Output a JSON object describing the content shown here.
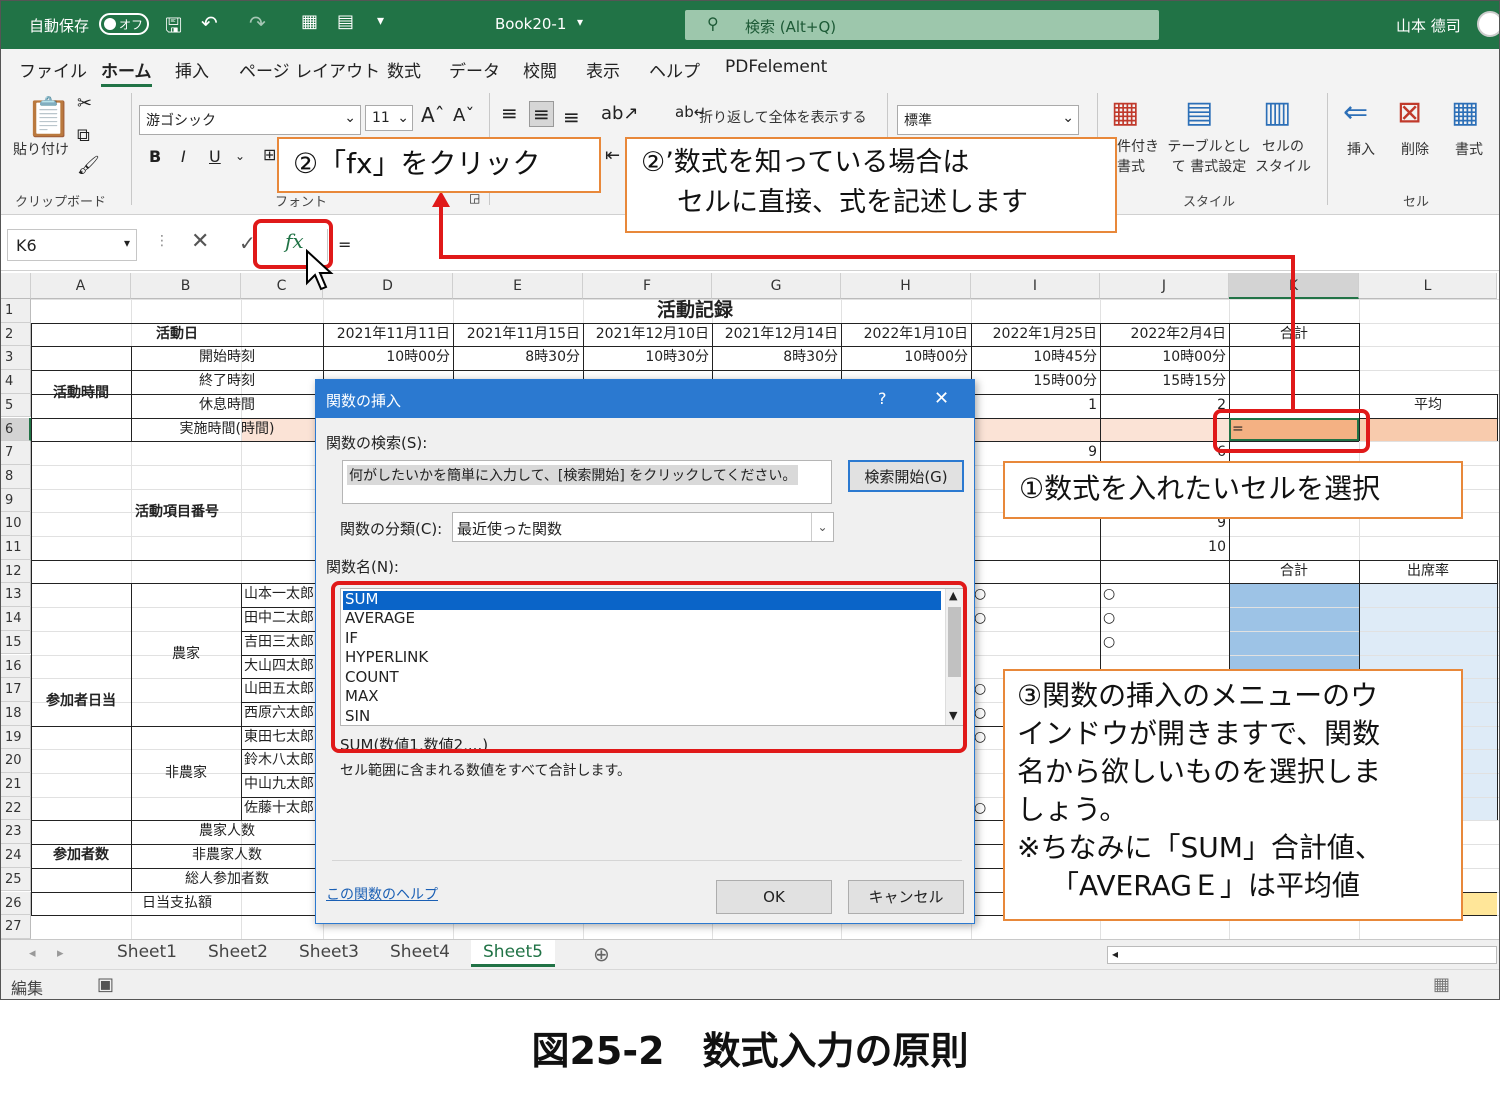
{
  "titlebar": {
    "autosave": "自動保存",
    "toggle": "オフ",
    "filename": "Book20-1",
    "search": "検索 (Alt+Q)",
    "user": "山本 德司"
  },
  "tabs": [
    "ファイル",
    "ホーム",
    "挿入",
    "ページ レイアウト",
    "数式",
    "データ",
    "校閲",
    "表示",
    "ヘルプ",
    "PDFelement"
  ],
  "ribbon": {
    "paste": "貼り付け",
    "clipboard": "クリップボード",
    "font_name": "游ゴシック",
    "font_size": "11",
    "font_label": "フォント",
    "wrap": "折り返して全体を表示する",
    "number_format": "標準",
    "cond_format": "件付き 書式",
    "table_format": "テーブルとして 書式設定",
    "cell_style": "セルの スタイル",
    "styles_label": "スタイル",
    "insert": "挿入",
    "delete": "削除",
    "format": "書式",
    "cells_label": "セル"
  },
  "formula_bar": {
    "name_box": "K6",
    "fx": "fx",
    "equals": "="
  },
  "columns": [
    "A",
    "B",
    "C",
    "D",
    "E",
    "F",
    "G",
    "H",
    "I",
    "J",
    "K",
    "L"
  ],
  "rows": [
    "1",
    "2",
    "3",
    "4",
    "5",
    "6",
    "7",
    "8",
    "9",
    "10",
    "11",
    "12",
    "13",
    "14",
    "15",
    "16",
    "17",
    "18",
    "19",
    "20",
    "21",
    "22",
    "23",
    "24",
    "25",
    "26",
    "27"
  ],
  "sheet": {
    "title": "活動記録",
    "activity_day": "活動日",
    "dates": [
      "2021年11月11日",
      "2021年11月15日",
      "2021年12月10日",
      "2021年12月14日",
      "2022年1月10日",
      "2022年1月25日",
      "2022年2月4日"
    ],
    "total": "合計",
    "start_label": "開始時刻",
    "start_times": [
      "10時00分",
      "8時30分",
      "10時30分",
      "8時30分",
      "10時00分",
      "10時45分",
      "10時00分"
    ],
    "end_label": "終了時刻",
    "end_times": [
      "15時00分",
      "15時15分"
    ],
    "break_label": "休息時間",
    "break_values": [
      "1",
      "2"
    ],
    "work_label": "実施時間(時間)",
    "activity_time": "活動時間",
    "average": "平均",
    "k6_value": "=",
    "activity_item": "活動項目番号",
    "item_nums": [
      "9",
      "6",
      "9",
      "10"
    ],
    "participant_day": "参加者日当",
    "farmer": "農家",
    "non_farmer": "非農家",
    "names": [
      "山本一太郎",
      "田中二太郎",
      "吉田三太郎",
      "大山四太郎",
      "山田五太郎",
      "西原六太郎",
      "東田七太郎",
      "鈴木八太郎",
      "中山九太郎",
      "佐藤十太郎"
    ],
    "sum_label": "合計",
    "attendance": "出席率",
    "circle": "○",
    "participants": "参加者数",
    "farmer_count": "農家人数",
    "non_farmer_count": "非農家人数",
    "total_count": "総人参加者数",
    "daily_pay": "日当支払額"
  },
  "sheet_tabs": [
    "Sheet1",
    "Sheet2",
    "Sheet3",
    "Sheet4",
    "Sheet5"
  ],
  "status": "編集",
  "dialog": {
    "title": "関数の挿入",
    "help": "?",
    "close": "✕",
    "search_label": "関数の検索(S):",
    "search_text": "何がしたいかを簡単に入力して、[検索開始] をクリックしてください。",
    "search_btn": "検索開始(G)",
    "category_label": "関数の分類(C):",
    "category": "最近使った関数",
    "name_label": "関数名(N):",
    "functions": [
      "SUM",
      "AVERAGE",
      "IF",
      "HYPERLINK",
      "COUNT",
      "MAX",
      "SIN"
    ],
    "syntax": "SUM(数値1,数値2,...)",
    "description": "セル範囲に含まれる数値をすべて合計します。",
    "help_link": "この関数のヘルプ",
    "ok": "OK",
    "cancel": "キャンセル"
  },
  "callouts": {
    "c1": "①数式を入れたいセルを選択",
    "c2": "②「fx」をクリック",
    "c2b": [
      "②’数式を知っている場合は",
      "セルに直接、式を記述します"
    ],
    "c3": [
      "③関数の挿入のメニューのウ",
      "インドウが開きますで、関数",
      "名から欲しいものを選択しま",
      "しょう。",
      "※ちなみに「SUM」合計値、",
      "「AVERAGＥ」は平均値"
    ]
  },
  "caption": "図25-2　数式入力の原則"
}
